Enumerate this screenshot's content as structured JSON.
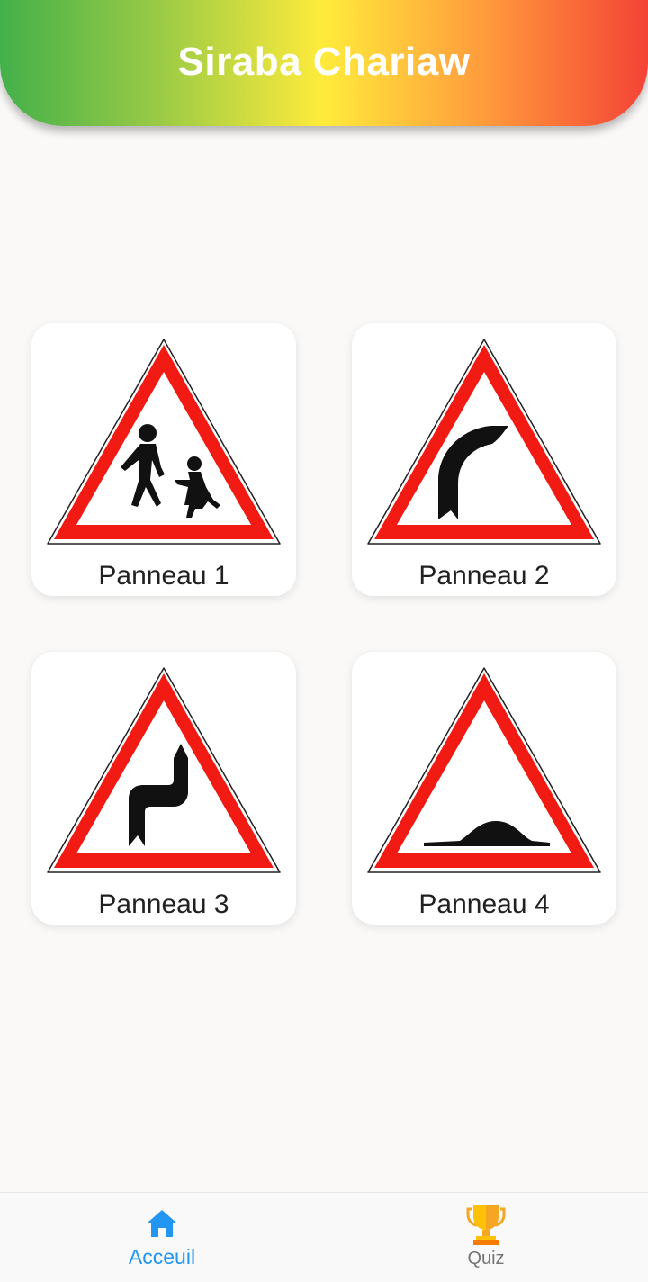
{
  "header": {
    "title": "Siraba Chariaw",
    "gradient_colors": [
      "#43b04a",
      "#ffeb3b",
      "#f44336"
    ]
  },
  "cards": [
    {
      "label": "Panneau 1",
      "icon": "children-crossing-sign-icon"
    },
    {
      "label": "Panneau 2",
      "icon": "right-bend-sign-icon"
    },
    {
      "label": "Panneau 3",
      "icon": "double-bend-sign-icon"
    },
    {
      "label": "Panneau 4",
      "icon": "speed-bump-sign-icon"
    }
  ],
  "bottom_nav": {
    "items": [
      {
        "label": "Acceuil",
        "icon": "home-icon",
        "active": true,
        "color": "#2196f3"
      },
      {
        "label": "Quiz",
        "icon": "trophy-icon",
        "active": false,
        "color": "#757575"
      }
    ]
  },
  "colors": {
    "sign_red": "#f21b13",
    "background": "#faf9f8",
    "accent": "#2196f3"
  }
}
